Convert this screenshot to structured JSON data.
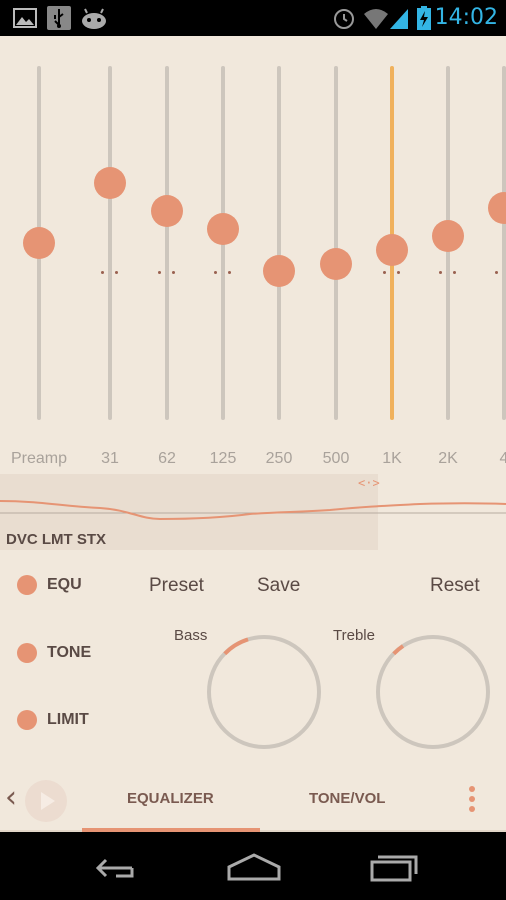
{
  "status_bar": {
    "time": "14:02",
    "icons": [
      "picture-icon",
      "usb-icon",
      "android-icon",
      "alarm-icon",
      "wifi-icon",
      "signal-icon",
      "battery-icon"
    ],
    "accent": "#33b5e5"
  },
  "equalizer": {
    "bands": [
      {
        "label": "Preamp",
        "level": 0.5
      },
      {
        "label": "31",
        "level": 0.67
      },
      {
        "label": "62",
        "level": 0.59
      },
      {
        "label": "125",
        "level": 0.54
      },
      {
        "label": "250",
        "level": 0.42
      },
      {
        "label": "500",
        "level": 0.44
      },
      {
        "label": "1K",
        "level": 0.48,
        "selected": true
      },
      {
        "label": "2K",
        "level": 0.52
      },
      {
        "label": "4",
        "level": 0.6
      }
    ],
    "colors": {
      "knob": "#e69474",
      "track": "#cdc6bd",
      "selected_track": "#f0b15c"
    }
  },
  "curve": {
    "indicator": "DVC LMT STX",
    "drag_glyph": "<·>"
  },
  "controls": {
    "toggles": [
      {
        "label": "EQU"
      },
      {
        "label": "TONE"
      },
      {
        "label": "LIMIT"
      }
    ],
    "actions": {
      "preset": "Preset",
      "save": "Save",
      "reset": "Reset"
    },
    "knobs": [
      {
        "label": "Bass",
        "level": 0.08
      },
      {
        "label": "Treble",
        "level": 0.08
      }
    ]
  },
  "tabs": {
    "back_glyph": "‹",
    "items": [
      "EQUALIZER",
      "TONE/VOL"
    ],
    "active": 0
  }
}
